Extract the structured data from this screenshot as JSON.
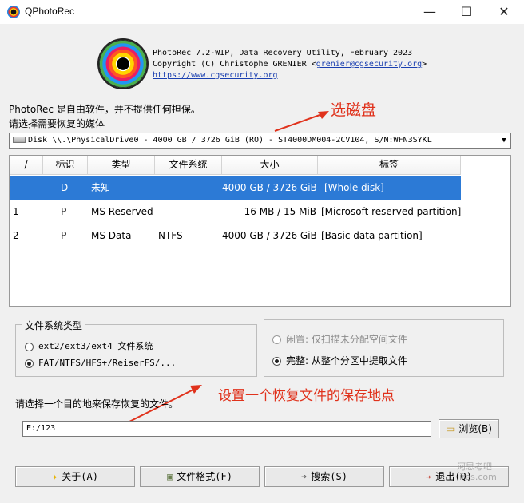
{
  "window": {
    "title": "QPhotoRec",
    "minimize_glyph": "—",
    "maximize_glyph": "☐",
    "close_glyph": "✕"
  },
  "header": {
    "line1": "PhotoRec 7.2-WIP, Data Recovery Utility, February 2023",
    "line2_prefix": "Copyright (C) Christophe GRENIER <",
    "email": "grenier@cgsecurity.org",
    "line2_suffix": ">",
    "url": "https://www.cgsecurity.org"
  },
  "intro": {
    "line1": "PhotoRec 是自由软件，并不提供任何担保。",
    "line2": "请选择需要恢复的媒体"
  },
  "annotations": {
    "select_disk": "选磁盘",
    "set_location": "设置一个恢复文件的保存地点",
    "color": "#e0321c"
  },
  "disk_select": {
    "value": "Disk \\\\.\\PhysicalDrive0 - 4000 GB / 3726 GiB (RO) - ST4000DM004-2CV104, S/N:WFN3SYKL",
    "arrow": "▼"
  },
  "table": {
    "headers": [
      "/",
      "标识",
      "类型",
      "文件系统",
      "大小",
      "标签"
    ],
    "rows": [
      {
        "num": "",
        "flag": "D",
        "type": "未知",
        "fs": "",
        "size": "4000 GB / 3726 GiB",
        "label": "[Whole disk]"
      },
      {
        "num": "1",
        "flag": "P",
        "type": "MS Reserved",
        "fs": "",
        "size": "16 MB / 15 MiB",
        "label": "[Microsoft reserved partition]"
      },
      {
        "num": "2",
        "flag": "P",
        "type": "MS Data",
        "fs": "NTFS",
        "size": "4000 GB / 3726 GiB",
        "label": "[Basic data partition]"
      }
    ],
    "selected_row": 0,
    "selection_color": "#2c7ad6"
  },
  "fs_group": {
    "title": "文件系统类型",
    "option1": "ext2/ext3/ext4 文件系统",
    "option2": "FAT/NTFS/HFS+/ReiserFS/...",
    "selected": "option2"
  },
  "scope_group": {
    "option1": "闲置: 仅扫描未分配空间文件",
    "option2": "完整: 从整个分区中提取文件",
    "selected": "option2"
  },
  "destination": {
    "label": "请选择一个目的地来保存恢复的文件。",
    "value": "E:/123",
    "browse_label": "浏览(B)"
  },
  "buttons": {
    "about": "关于(A)",
    "formats": "文件格式(F)",
    "search": "搜索(S)",
    "exit": "退出(Q)"
  },
  "watermark": {
    "line1": "河思考吧",
    "line2": "jires.com"
  }
}
